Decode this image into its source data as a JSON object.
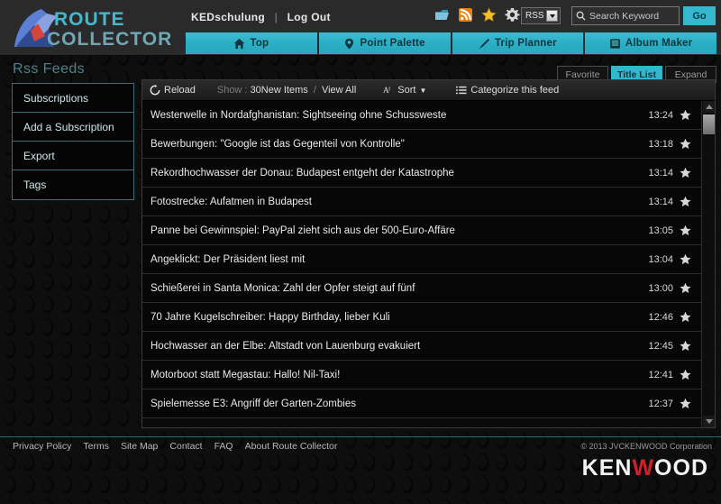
{
  "header": {
    "logo_line1": "ROUTE",
    "logo_line2": "COLLECTOR",
    "user": "KEDschulung",
    "separator": "|",
    "logout": "Log Out",
    "icons": [
      "feed-folder-icon",
      "rss-icon",
      "star-icon",
      "gear-icon"
    ],
    "search_scope": "RSS",
    "search_placeholder": "Search Keyword",
    "search_value": "",
    "go_label": "Go",
    "tabs": [
      {
        "label": "Top",
        "icon": "home-icon"
      },
      {
        "label": "Point Palette",
        "icon": "map-pin-icon"
      },
      {
        "label": "Trip Planner",
        "icon": "pencil-icon"
      },
      {
        "label": "Album Maker",
        "icon": "book-icon"
      }
    ]
  },
  "sidebar": {
    "title": "Rss Feeds",
    "items": [
      {
        "label": "Subscriptions"
      },
      {
        "label": "Add a Subscription"
      },
      {
        "label": "Export"
      },
      {
        "label": "Tags"
      }
    ]
  },
  "view_buttons": [
    {
      "label": "Favorite",
      "active": false
    },
    {
      "label": "Title List",
      "active": true
    },
    {
      "label": "Expand",
      "active": false
    }
  ],
  "feed_toolbar": {
    "reload": "Reload",
    "show_label": "Show :",
    "new_items": "30New Items",
    "slash": "/",
    "view_all": "View All",
    "sort": "Sort",
    "sort_caret": "▼",
    "categorize": "Categorize this feed"
  },
  "feed_items": [
    {
      "title": "Westerwelle in Nordafghanistan: Sightseeing ohne Schussweste",
      "time": "13:24"
    },
    {
      "title": "Bewerbungen: \"Google ist das Gegenteil von Kontrolle\"",
      "time": "13:18"
    },
    {
      "title": "Rekordhochwasser der Donau: Budapest entgeht der Katastrophe",
      "time": "13:14"
    },
    {
      "title": "Fotostrecke: Aufatmen in Budapest",
      "time": "13:14"
    },
    {
      "title": "Panne bei Gewinnspiel: PayPal zieht sich aus der 500-Euro-Affäre",
      "time": "13:05"
    },
    {
      "title": "Angeklickt: Der Präsident liest mit",
      "time": "13:04"
    },
    {
      "title": "Schießerei in Santa Monica: Zahl der Opfer steigt auf fünf",
      "time": "13:00"
    },
    {
      "title": "70 Jahre Kugelschreiber: Happy Birthday, lieber Kuli",
      "time": "12:46"
    },
    {
      "title": "Hochwasser an der Elbe: Altstadt von Lauenburg evakuiert",
      "time": "12:45"
    },
    {
      "title": "Motorboot statt Megastau: Hallo! Nil-Taxi!",
      "time": "12:41"
    },
    {
      "title": "Spielemesse E3: Angriff der Garten-Zombies",
      "time": "12:37"
    }
  ],
  "footer": {
    "links": [
      "Privacy Policy",
      "Terms",
      "Site Map",
      "Contact",
      "FAQ",
      "About Route Collector"
    ],
    "copyright": "© 2013 JVCKENWOOD Corporation",
    "brand_left": "KEN",
    "brand_dot": "W",
    "brand_right": "OOD"
  },
  "colors": {
    "accent": "#34b6cc",
    "header_bg": "#2a2a2a",
    "panel_bg": "#0a0a0a",
    "title_teal": "#4f8088",
    "brand_red": "#d0202a"
  }
}
